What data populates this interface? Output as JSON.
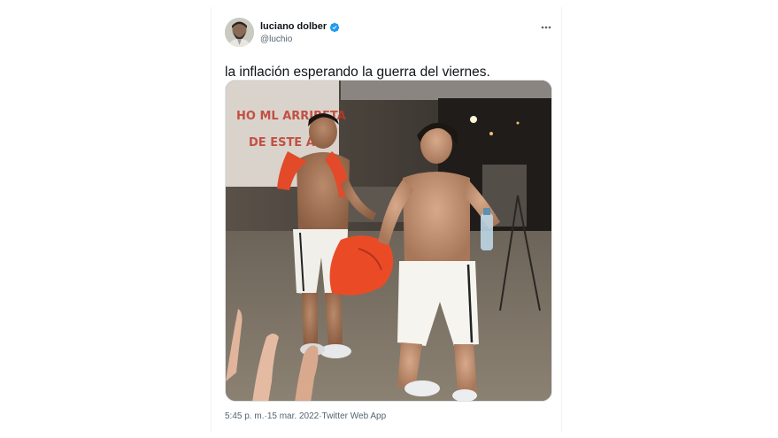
{
  "tweet": {
    "author": {
      "display_name": "luciano dolber",
      "username": "@luchio",
      "verified": true,
      "verified_icon": "verified-badge-icon",
      "avatar_icon": "avatar"
    },
    "more_icon": "more-horizontal-icon",
    "text": "la inflación esperando la guerra del viernes.",
    "media": {
      "type": "photo"
    },
    "meta": {
      "time": "5:45 p. m.",
      "separator_1": " · ",
      "date": "15 mar. 2022",
      "separator_2": " · ",
      "source": "Twitter Web App"
    }
  },
  "colors": {
    "text_primary": "#0f1419",
    "text_secondary": "#536471",
    "verified_blue": "#1d9bf0",
    "border": "#eff3f4"
  }
}
